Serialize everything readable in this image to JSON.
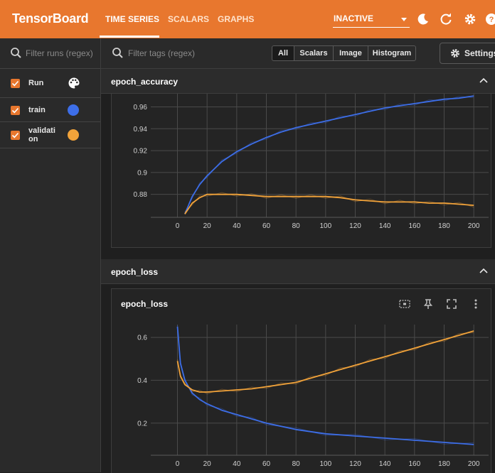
{
  "app": {
    "brand": "TensorBoard",
    "nav": [
      "TIME SERIES",
      "SCALARS",
      "GRAPHS"
    ],
    "reload_status": "INACTIVE",
    "accent_color": "#e8772e"
  },
  "sidebar": {
    "filter_placeholder": "Filter runs (regex)",
    "header_label": "Run",
    "runs": [
      {
        "name": "train",
        "color": "#3d6ee8"
      },
      {
        "name": "validati on",
        "color": "#f2a33a"
      }
    ]
  },
  "toolbar": {
    "filter_placeholder": "Filter tags (regex)",
    "type_filters": [
      "All",
      "Scalars",
      "Image",
      "Histogram"
    ],
    "active_type_filter": "All",
    "settings_label": "Settings"
  },
  "groups": [
    {
      "name": "epoch_accuracy"
    },
    {
      "name": "epoch_loss",
      "card_title": "epoch_loss"
    }
  ],
  "chart_data": [
    {
      "type": "line",
      "title": "epoch_accuracy",
      "xlim": [
        -18,
        210
      ],
      "ylim": [
        0.859,
        0.972
      ],
      "x_ticks": [
        0,
        20,
        40,
        60,
        80,
        100,
        120,
        140,
        160,
        180,
        200
      ],
      "y_ticks": [
        0.88,
        0.9,
        0.92,
        0.94,
        0.96
      ],
      "y_tick_labels": [
        "0.88",
        "0.9",
        "0.92",
        "0.94",
        "0.96"
      ],
      "grid": true,
      "series": [
        {
          "name": "train",
          "color": "#3d6ee8",
          "x": [
            5,
            10,
            15,
            20,
            30,
            40,
            50,
            60,
            70,
            80,
            90,
            100,
            110,
            120,
            130,
            140,
            150,
            160,
            170,
            180,
            190,
            200
          ],
          "y": [
            0.862,
            0.878,
            0.889,
            0.897,
            0.91,
            0.919,
            0.926,
            0.932,
            0.937,
            0.941,
            0.944,
            0.947,
            0.95,
            0.953,
            0.956,
            0.959,
            0.961,
            0.963,
            0.965,
            0.967,
            0.968,
            0.97
          ]
        },
        {
          "name": "validati on",
          "color": "#f2a33a",
          "x": [
            5,
            10,
            15,
            20,
            30,
            40,
            50,
            60,
            70,
            80,
            90,
            100,
            110,
            120,
            130,
            140,
            150,
            160,
            170,
            180,
            190,
            200
          ],
          "y": [
            0.862,
            0.872,
            0.877,
            0.88,
            0.88,
            0.88,
            0.879,
            0.878,
            0.878,
            0.878,
            0.878,
            0.878,
            0.877,
            0.875,
            0.874,
            0.873,
            0.873,
            0.873,
            0.872,
            0.872,
            0.871,
            0.87
          ]
        }
      ]
    },
    {
      "type": "line",
      "title": "epoch_loss",
      "xlim": [
        -18,
        210
      ],
      "ylim": [
        0.05,
        0.66
      ],
      "x_ticks": [
        0,
        20,
        40,
        60,
        80,
        100,
        120,
        140,
        160,
        180,
        200
      ],
      "y_ticks": [
        0.2,
        0.4,
        0.6
      ],
      "y_tick_labels": [
        "0.2",
        "0.4",
        "0.6"
      ],
      "grid": true,
      "series": [
        {
          "name": "train",
          "color": "#3d6ee8",
          "x": [
            0,
            2,
            5,
            10,
            15,
            20,
            30,
            40,
            50,
            60,
            80,
            100,
            120,
            140,
            160,
            180,
            200
          ],
          "y": [
            0.65,
            0.48,
            0.4,
            0.34,
            0.31,
            0.29,
            0.26,
            0.24,
            0.22,
            0.2,
            0.17,
            0.15,
            0.14,
            0.13,
            0.12,
            0.11,
            0.1
          ]
        },
        {
          "name": "validati on",
          "color": "#f2a33a",
          "x": [
            0,
            2,
            5,
            10,
            15,
            20,
            30,
            40,
            50,
            60,
            70,
            80,
            90,
            100,
            110,
            120,
            130,
            140,
            150,
            160,
            170,
            180,
            190,
            200
          ],
          "y": [
            0.49,
            0.42,
            0.38,
            0.355,
            0.345,
            0.345,
            0.35,
            0.355,
            0.36,
            0.37,
            0.38,
            0.39,
            0.41,
            0.43,
            0.45,
            0.47,
            0.49,
            0.51,
            0.53,
            0.55,
            0.57,
            0.59,
            0.61,
            0.63
          ]
        }
      ]
    }
  ]
}
